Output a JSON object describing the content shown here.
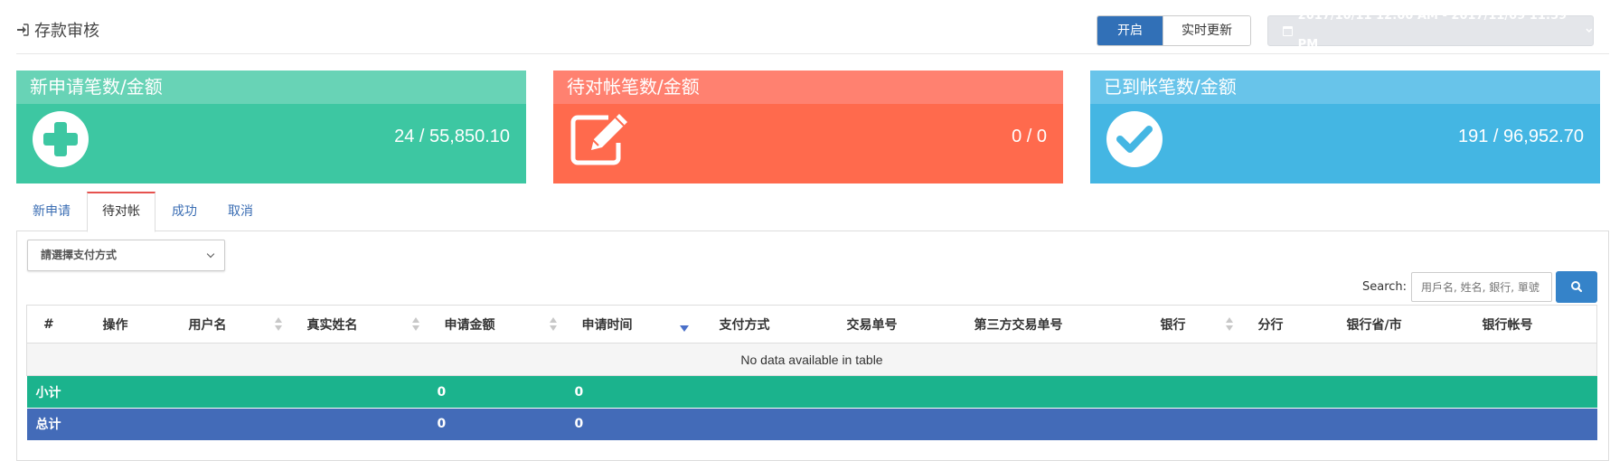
{
  "header": {
    "title": "存款审核",
    "toggle_on": "开启",
    "toggle_realtime": "实时更新",
    "date_range": "2017/10/11 12:00 AM - 2017/11/09 11:59 PM"
  },
  "cards": [
    {
      "title": "新申请笔数/金额",
      "value": "24 / 55,850.10",
      "icon": "plus-circle-icon",
      "color": "#3dc7a2"
    },
    {
      "title": "待对帐笔数/金额",
      "value": "0 / 0",
      "icon": "edit-icon",
      "color": "#ff6a4d"
    },
    {
      "title": "已到帐笔数/金额",
      "value": "191 / 96,952.70",
      "icon": "check-circle-icon",
      "color": "#44b6e3"
    }
  ],
  "tabs": [
    {
      "label": "新申请",
      "active": false
    },
    {
      "label": "待对帐",
      "active": true
    },
    {
      "label": "成功",
      "active": false
    },
    {
      "label": "取消",
      "active": false
    }
  ],
  "filter": {
    "payment_select": "請選擇支付方式"
  },
  "search": {
    "label": "Search:",
    "placeholder": "用戶名, 姓名, 銀行, 單號"
  },
  "table": {
    "columns": [
      "#",
      "操作",
      "用户名",
      "真实姓名",
      "申请金额",
      "申请时间",
      "支付方式",
      "交易单号",
      "第三方交易单号",
      "银行",
      "分行",
      "银行省/市",
      "银行帐号"
    ],
    "empty_message": "No data available in table",
    "subtotal": {
      "label": "小计",
      "amount": "0",
      "time": "0"
    },
    "total": {
      "label": "总计",
      "amount": "0",
      "time": "0"
    }
  }
}
